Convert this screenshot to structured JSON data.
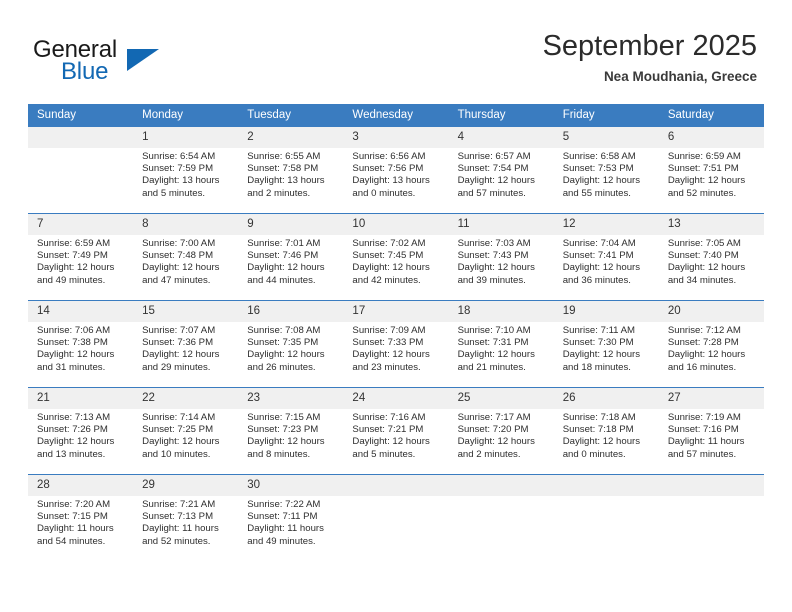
{
  "brand": {
    "name_part1": "General",
    "name_part2": "Blue",
    "accent_color": "#1268b3"
  },
  "header": {
    "title": "September 2025",
    "location": "Nea Moudhania, Greece"
  },
  "theme": {
    "header_row_color": "#3a7cc0",
    "daynum_background": "#f0f0f0"
  },
  "weekday_headers": [
    "Sunday",
    "Monday",
    "Tuesday",
    "Wednesday",
    "Thursday",
    "Friday",
    "Saturday"
  ],
  "labels": {
    "sunrise_prefix": "Sunrise:",
    "sunset_prefix": "Sunset:",
    "daylight_prefix": "Daylight:"
  },
  "weeks": [
    [
      {
        "day": "",
        "sunrise": "",
        "sunset": "",
        "daylight": "",
        "empty": true
      },
      {
        "day": "1",
        "sunrise": "Sunrise: 6:54 AM",
        "sunset": "Sunset: 7:59 PM",
        "daylight": "Daylight: 13 hours and 5 minutes."
      },
      {
        "day": "2",
        "sunrise": "Sunrise: 6:55 AM",
        "sunset": "Sunset: 7:58 PM",
        "daylight": "Daylight: 13 hours and 2 minutes."
      },
      {
        "day": "3",
        "sunrise": "Sunrise: 6:56 AM",
        "sunset": "Sunset: 7:56 PM",
        "daylight": "Daylight: 13 hours and 0 minutes."
      },
      {
        "day": "4",
        "sunrise": "Sunrise: 6:57 AM",
        "sunset": "Sunset: 7:54 PM",
        "daylight": "Daylight: 12 hours and 57 minutes."
      },
      {
        "day": "5",
        "sunrise": "Sunrise: 6:58 AM",
        "sunset": "Sunset: 7:53 PM",
        "daylight": "Daylight: 12 hours and 55 minutes."
      },
      {
        "day": "6",
        "sunrise": "Sunrise: 6:59 AM",
        "sunset": "Sunset: 7:51 PM",
        "daylight": "Daylight: 12 hours and 52 minutes."
      }
    ],
    [
      {
        "day": "7",
        "sunrise": "Sunrise: 6:59 AM",
        "sunset": "Sunset: 7:49 PM",
        "daylight": "Daylight: 12 hours and 49 minutes."
      },
      {
        "day": "8",
        "sunrise": "Sunrise: 7:00 AM",
        "sunset": "Sunset: 7:48 PM",
        "daylight": "Daylight: 12 hours and 47 minutes."
      },
      {
        "day": "9",
        "sunrise": "Sunrise: 7:01 AM",
        "sunset": "Sunset: 7:46 PM",
        "daylight": "Daylight: 12 hours and 44 minutes."
      },
      {
        "day": "10",
        "sunrise": "Sunrise: 7:02 AM",
        "sunset": "Sunset: 7:45 PM",
        "daylight": "Daylight: 12 hours and 42 minutes."
      },
      {
        "day": "11",
        "sunrise": "Sunrise: 7:03 AM",
        "sunset": "Sunset: 7:43 PM",
        "daylight": "Daylight: 12 hours and 39 minutes."
      },
      {
        "day": "12",
        "sunrise": "Sunrise: 7:04 AM",
        "sunset": "Sunset: 7:41 PM",
        "daylight": "Daylight: 12 hours and 36 minutes."
      },
      {
        "day": "13",
        "sunrise": "Sunrise: 7:05 AM",
        "sunset": "Sunset: 7:40 PM",
        "daylight": "Daylight: 12 hours and 34 minutes."
      }
    ],
    [
      {
        "day": "14",
        "sunrise": "Sunrise: 7:06 AM",
        "sunset": "Sunset: 7:38 PM",
        "daylight": "Daylight: 12 hours and 31 minutes."
      },
      {
        "day": "15",
        "sunrise": "Sunrise: 7:07 AM",
        "sunset": "Sunset: 7:36 PM",
        "daylight": "Daylight: 12 hours and 29 minutes."
      },
      {
        "day": "16",
        "sunrise": "Sunrise: 7:08 AM",
        "sunset": "Sunset: 7:35 PM",
        "daylight": "Daylight: 12 hours and 26 minutes."
      },
      {
        "day": "17",
        "sunrise": "Sunrise: 7:09 AM",
        "sunset": "Sunset: 7:33 PM",
        "daylight": "Daylight: 12 hours and 23 minutes."
      },
      {
        "day": "18",
        "sunrise": "Sunrise: 7:10 AM",
        "sunset": "Sunset: 7:31 PM",
        "daylight": "Daylight: 12 hours and 21 minutes."
      },
      {
        "day": "19",
        "sunrise": "Sunrise: 7:11 AM",
        "sunset": "Sunset: 7:30 PM",
        "daylight": "Daylight: 12 hours and 18 minutes."
      },
      {
        "day": "20",
        "sunrise": "Sunrise: 7:12 AM",
        "sunset": "Sunset: 7:28 PM",
        "daylight": "Daylight: 12 hours and 16 minutes."
      }
    ],
    [
      {
        "day": "21",
        "sunrise": "Sunrise: 7:13 AM",
        "sunset": "Sunset: 7:26 PM",
        "daylight": "Daylight: 12 hours and 13 minutes."
      },
      {
        "day": "22",
        "sunrise": "Sunrise: 7:14 AM",
        "sunset": "Sunset: 7:25 PM",
        "daylight": "Daylight: 12 hours and 10 minutes."
      },
      {
        "day": "23",
        "sunrise": "Sunrise: 7:15 AM",
        "sunset": "Sunset: 7:23 PM",
        "daylight": "Daylight: 12 hours and 8 minutes."
      },
      {
        "day": "24",
        "sunrise": "Sunrise: 7:16 AM",
        "sunset": "Sunset: 7:21 PM",
        "daylight": "Daylight: 12 hours and 5 minutes."
      },
      {
        "day": "25",
        "sunrise": "Sunrise: 7:17 AM",
        "sunset": "Sunset: 7:20 PM",
        "daylight": "Daylight: 12 hours and 2 minutes."
      },
      {
        "day": "26",
        "sunrise": "Sunrise: 7:18 AM",
        "sunset": "Sunset: 7:18 PM",
        "daylight": "Daylight: 12 hours and 0 minutes."
      },
      {
        "day": "27",
        "sunrise": "Sunrise: 7:19 AM",
        "sunset": "Sunset: 7:16 PM",
        "daylight": "Daylight: 11 hours and 57 minutes."
      }
    ],
    [
      {
        "day": "28",
        "sunrise": "Sunrise: 7:20 AM",
        "sunset": "Sunset: 7:15 PM",
        "daylight": "Daylight: 11 hours and 54 minutes."
      },
      {
        "day": "29",
        "sunrise": "Sunrise: 7:21 AM",
        "sunset": "Sunset: 7:13 PM",
        "daylight": "Daylight: 11 hours and 52 minutes."
      },
      {
        "day": "30",
        "sunrise": "Sunrise: 7:22 AM",
        "sunset": "Sunset: 7:11 PM",
        "daylight": "Daylight: 11 hours and 49 minutes."
      },
      {
        "day": "",
        "sunrise": "",
        "sunset": "",
        "daylight": "",
        "empty": true
      },
      {
        "day": "",
        "sunrise": "",
        "sunset": "",
        "daylight": "",
        "empty": true
      },
      {
        "day": "",
        "sunrise": "",
        "sunset": "",
        "daylight": "",
        "empty": true
      },
      {
        "day": "",
        "sunrise": "",
        "sunset": "",
        "daylight": "",
        "empty": true
      }
    ]
  ]
}
